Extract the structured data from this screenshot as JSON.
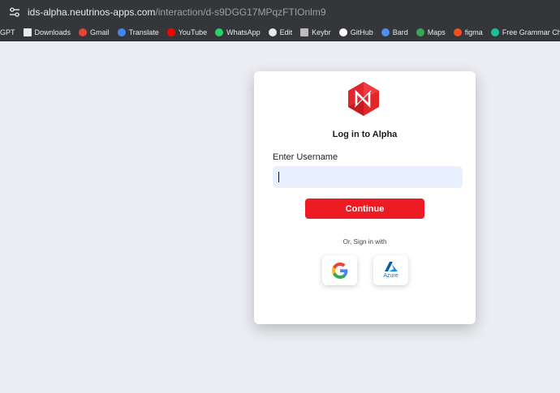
{
  "browser": {
    "url_host": "ids-alpha.neutrinos-apps.com",
    "url_path": "/interaction/d-s9DGG17MPqzFTIOnlm9",
    "bookmarks": [
      {
        "label": "GPT",
        "icon": "chatgpt-icon",
        "color": "#ffffff"
      },
      {
        "label": "Downloads",
        "icon": "download-icon",
        "color": "#e8eaed"
      },
      {
        "label": "Gmail",
        "icon": "gmail-icon",
        "color": "#ea4335"
      },
      {
        "label": "Translate",
        "icon": "translate-icon",
        "color": "#4285f4"
      },
      {
        "label": "YouTube",
        "icon": "youtube-icon",
        "color": "#ff0000"
      },
      {
        "label": "WhatsApp",
        "icon": "whatsapp-icon",
        "color": "#25d366"
      },
      {
        "label": "Edit",
        "icon": "globe-icon",
        "color": "#e8eaed"
      },
      {
        "label": "Keybr",
        "icon": "keybr-icon",
        "color": "#bbbbbb"
      },
      {
        "label": "GitHub",
        "icon": "github-icon",
        "color": "#ffffff"
      },
      {
        "label": "Bard",
        "icon": "bard-icon",
        "color": "#4f8df5"
      },
      {
        "label": "Maps",
        "icon": "maps-icon",
        "color": "#34a853"
      },
      {
        "label": "figma",
        "icon": "figma-icon",
        "color": "#f24e1e"
      },
      {
        "label": "Free Grammar Chec...",
        "icon": "grammar-icon",
        "color": "#15c39a"
      }
    ]
  },
  "login": {
    "title": "Log in to Alpha",
    "username_label": "Enter Username",
    "username_value": "",
    "continue_label": "Continue",
    "divider_text": "Or, Sign in with",
    "azure_label": "Azure"
  },
  "colors": {
    "brand_red": "#ed1c24",
    "input_bg": "#e8f0fe",
    "page_bg": "#ebedf2"
  }
}
